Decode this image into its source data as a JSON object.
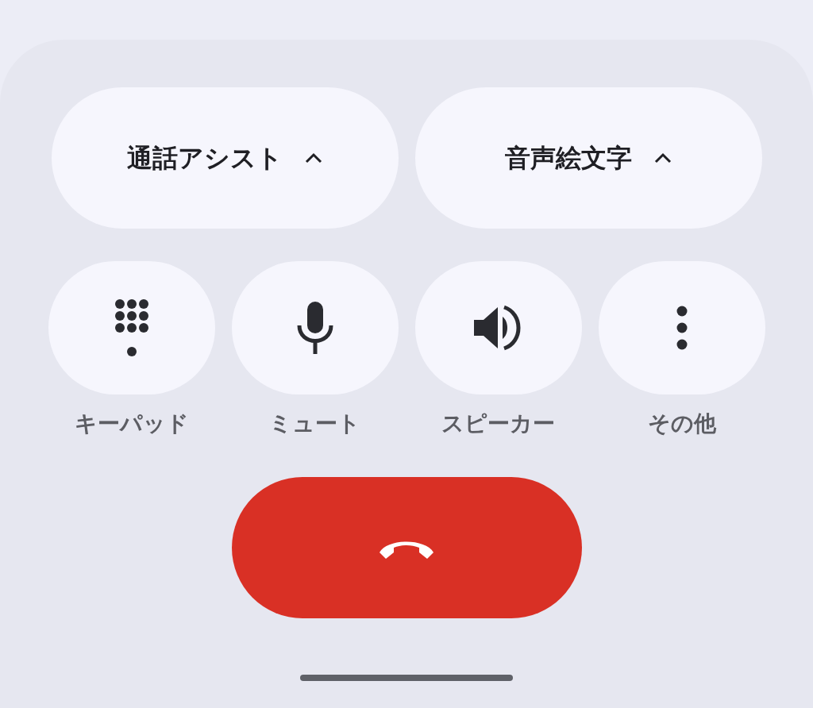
{
  "assist_buttons": [
    {
      "label": "通話アシスト"
    },
    {
      "label": "音声絵文字"
    }
  ],
  "controls": [
    {
      "kind": "keypad",
      "label": "キーパッド"
    },
    {
      "kind": "mute",
      "label": "ミュート"
    },
    {
      "kind": "speaker",
      "label": "スピーカー"
    },
    {
      "kind": "more",
      "label": "その他"
    }
  ]
}
